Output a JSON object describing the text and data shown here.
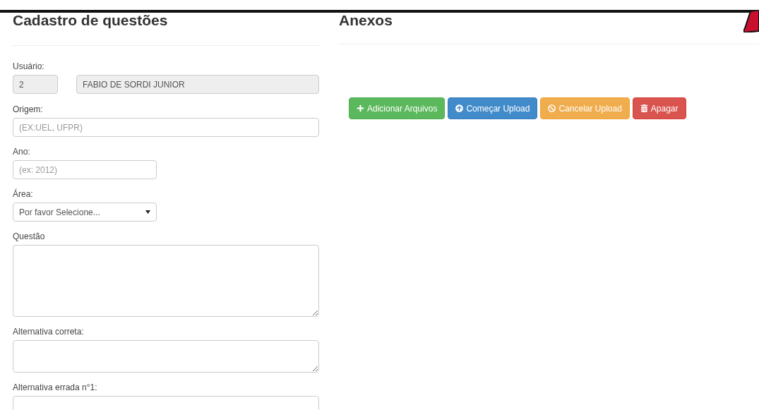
{
  "form": {
    "title": "Cadastro de questões",
    "fields": [
      {
        "kind": "pair",
        "label": "Usuário:",
        "values": [
          "2",
          "FABIO DE SORDI JUNIOR"
        ]
      },
      {
        "kind": "text",
        "label": "Origem:",
        "placeholder": "(EX:UEL, UFPR)"
      },
      {
        "kind": "text",
        "label": "Ano:",
        "placeholder": "(ex: 2012)"
      },
      {
        "kind": "select",
        "label": "Área:",
        "value": "Por favor Selecione..."
      },
      {
        "kind": "textarea",
        "label": "Questão"
      },
      {
        "kind": "textarea",
        "label": "Alternativa correta:"
      },
      {
        "kind": "textarea",
        "label": "Alternativa errada n°1:"
      }
    ]
  },
  "attachments": {
    "title": "Anexos",
    "buttons": [
      {
        "label": "Adicionar Arquivos",
        "kind": "add"
      },
      {
        "label": "Começar Upload",
        "kind": "upload"
      },
      {
        "label": "Cancelar Upload",
        "kind": "cancel"
      },
      {
        "label": "Apagar",
        "kind": "delete"
      }
    ]
  }
}
